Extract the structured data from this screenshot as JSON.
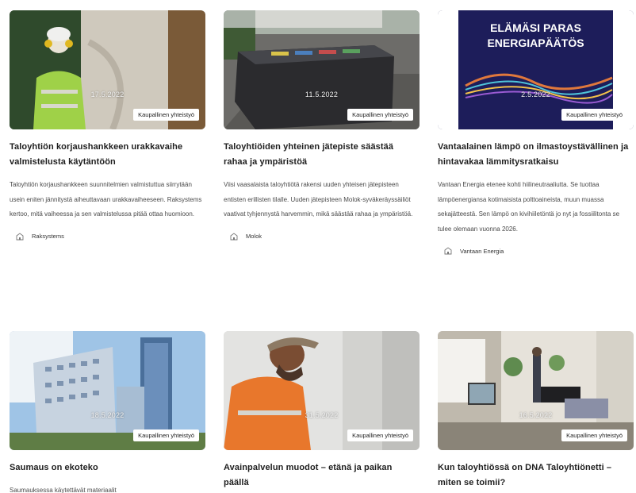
{
  "articles": [
    {
      "date": "17.5.2022",
      "badge": "Kaupallinen yhteistyö",
      "title": "Taloyhtiön korjaushankkeen urakkavaihe valmistelusta käytäntöön",
      "excerpt": "Taloyhtiön korjaushankkeen suunnitelmien valmistuttua siirrytään usein eniten jännitystä aiheuttavaan urakkavaiheeseen. Raksystems kertoo, mitä vaiheessa ja sen valmistelussa pitää ottaa huomioon.",
      "author": "Raksystems"
    },
    {
      "date": "11.5.2022",
      "badge": "Kaupallinen yhteistyö",
      "title": "Taloyhtiöiden yhteinen jätepiste säästää rahaa ja ympäristöä",
      "excerpt": "Viisi vaasalaista taloyhtiötä rakensi uuden yhteisen jätepisteen entisten erillisten tilalle. Uuden jätepisteen Molok-syväkeräyssäiliöt vaativat tyhjennystä harvemmin, mikä säästää rahaa ja ympäristöä.",
      "author": "Molok"
    },
    {
      "date": "2.5.2022",
      "badge": "Kaupallinen yhteistyö",
      "title": "Vantaalainen lämpö on ilmastoystävällinen ja hintavakaa lämmitysratkaisu",
      "excerpt": "Vantaan Energia etenee kohti hiilineutraaliutta. Se tuottaa lämpöenergiansa kotimaisista polttoaineista, muun muassa sekajätteestä. Sen lämpö on kivihiiletöntä jo nyt ja fossiilitonta se tulee olemaan vuonna 2026.",
      "author": "Vantaan Energia",
      "image_text": [
        "ELÄMÄSI PARAS",
        "ENERGIAPÄÄTÖS"
      ]
    },
    {
      "date": "18.5.2022",
      "badge": "Kaupallinen yhteistyö",
      "title": "Saumaus on ekoteko",
      "excerpt": "Saumauksessa käytettävät materiaalit",
      "author": ""
    },
    {
      "date": "31.5.2022",
      "badge": "Kaupallinen yhteistyö",
      "title": "Avainpalvelun muodot – etänä ja paikan päällä",
      "excerpt": "",
      "author": ""
    },
    {
      "date": "16.5.2022",
      "badge": "Kaupallinen yhteistyö",
      "title": "Kun taloyhtiössä on DNA Taloyhtiönetti – miten se toimii?",
      "excerpt": "",
      "author": ""
    }
  ]
}
